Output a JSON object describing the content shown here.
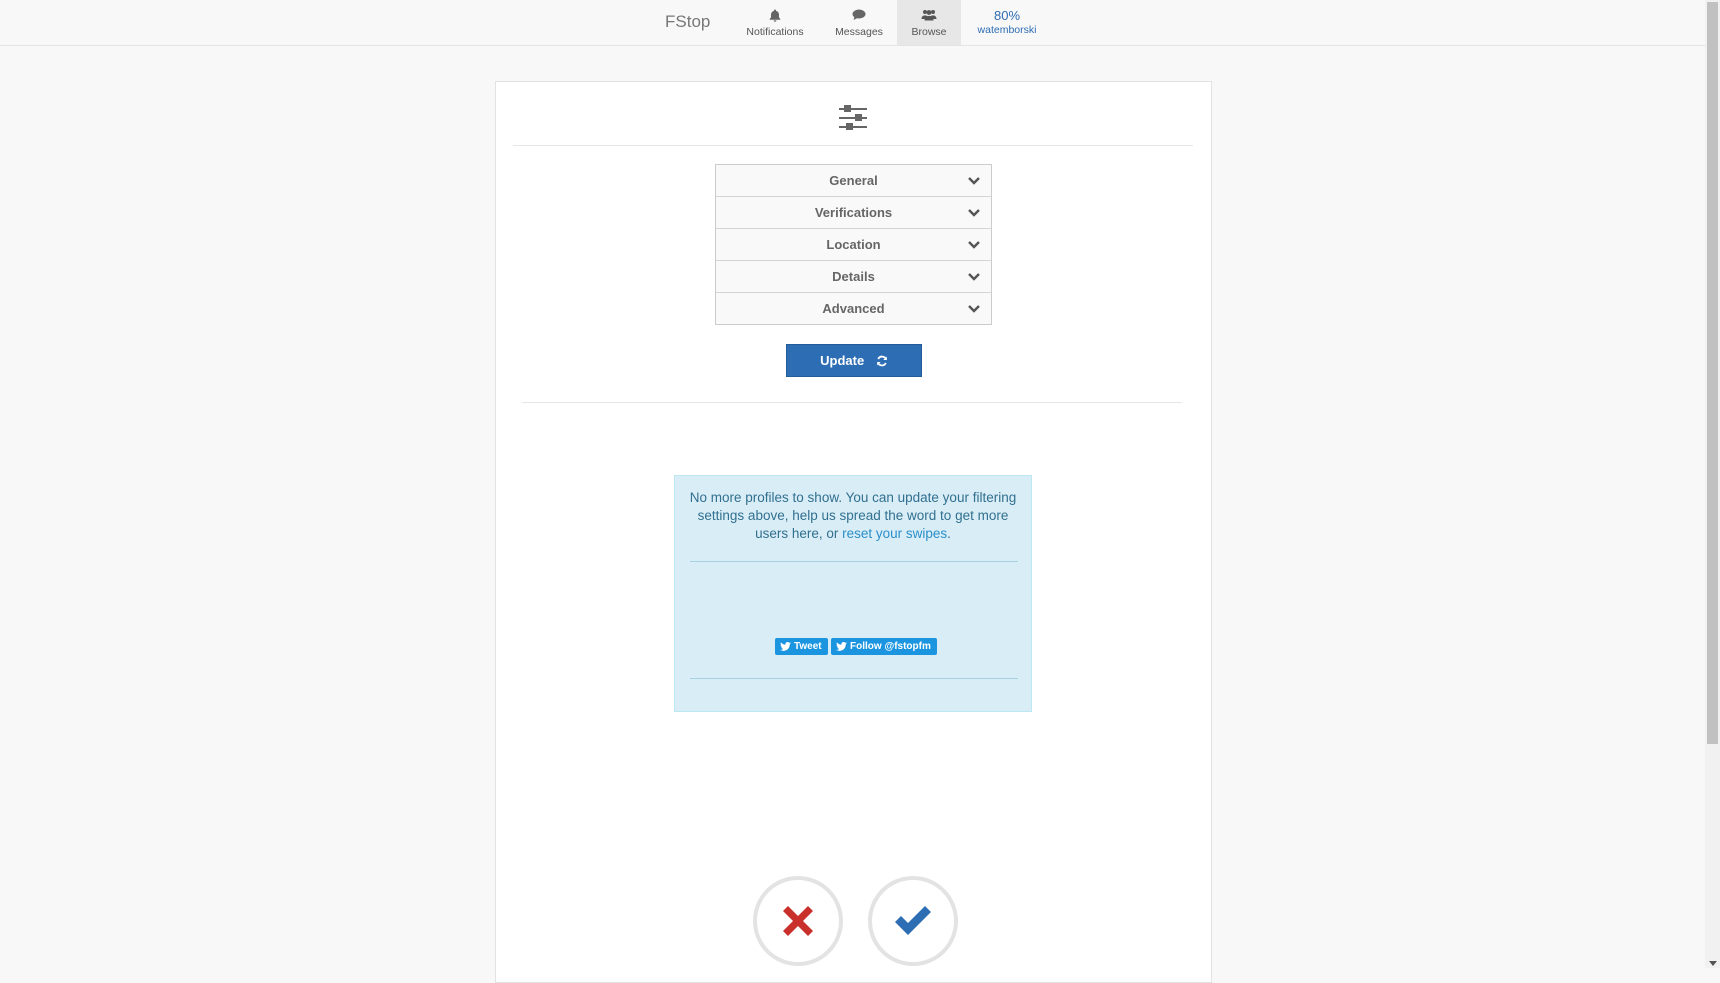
{
  "nav": {
    "brand": "FStop",
    "notifications": "Notifications",
    "messages": "Messages",
    "browse": "Browse",
    "user_percent": "80%",
    "username": "watemborski",
    "icons": [
      "bell-icon",
      "comment-icon",
      "users-icon"
    ]
  },
  "filters": {
    "icon": "sliders-icon",
    "sections": [
      "General",
      "Verifications",
      "Location",
      "Details",
      "Advanced"
    ],
    "update_label": "Update"
  },
  "info": {
    "message_before": "No more profiles to show. You can update your filtering settings above, help us spread the word to get more users here, or ",
    "link_text": "reset your swipes",
    "message_after": ".",
    "tweet_label": "Tweet",
    "follow_label": "Follow @fstopfm"
  },
  "actions": {
    "reject_icon": "x-icon",
    "accept_icon": "check-icon"
  },
  "colors": {
    "accent": "#2d6db3",
    "info_bg": "#d9edf7",
    "reject": "#c9302c",
    "twitter": "#1b95e0"
  }
}
